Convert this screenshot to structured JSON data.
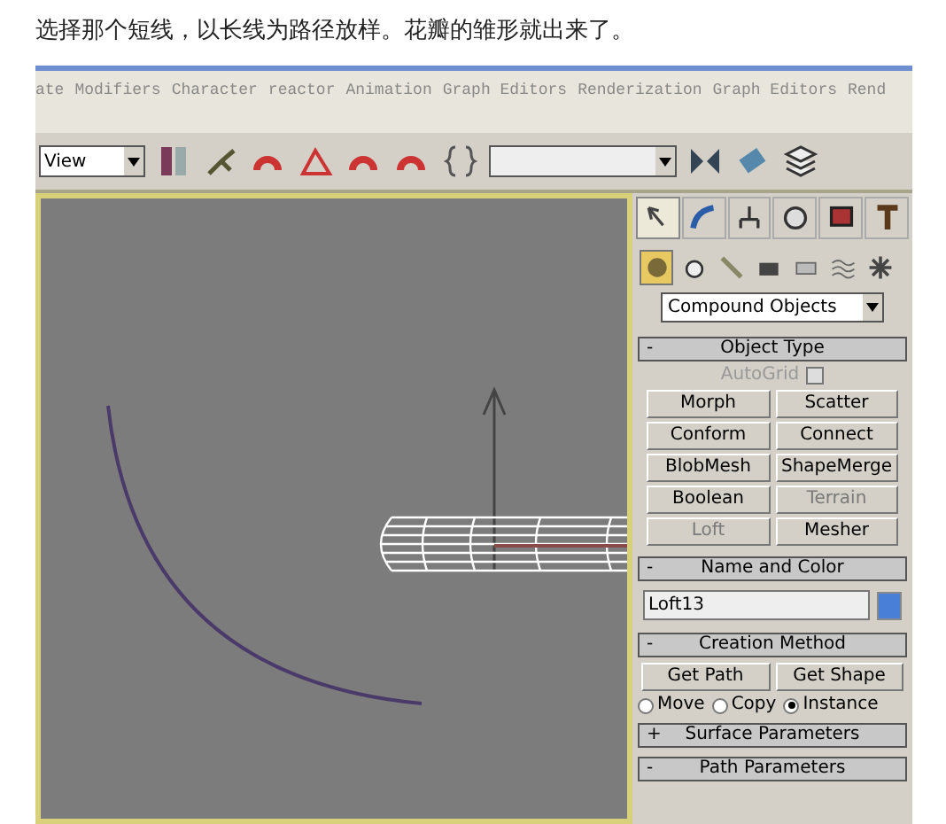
{
  "caption": "选择那个短线，以长线为路径放样。花瓣的雏形就出来了。",
  "menu": [
    "ate",
    "Modifiers",
    "Character",
    "reactor",
    "Animation",
    "Graph Editors",
    "Renderization",
    "Graph Editors",
    "Rend"
  ],
  "toolbar": {
    "view_dropdown": "View"
  },
  "command_panel": {
    "tabs": [
      {
        "selected": true
      },
      {
        "selected": false
      },
      {
        "selected": false
      },
      {
        "selected": false
      },
      {
        "selected": false
      },
      {
        "selected": false
      }
    ],
    "categories": [
      {
        "selected": true
      },
      {
        "selected": false
      },
      {
        "selected": false
      },
      {
        "selected": false
      },
      {
        "selected": false
      },
      {
        "selected": false
      },
      {
        "selected": false
      }
    ],
    "type_dropdown": "Compound Objects",
    "object_type": {
      "toggle": "-",
      "title": "Object Type",
      "autogrid": {
        "label": "AutoGrid",
        "checked": false,
        "disabled": true
      },
      "buttons": [
        {
          "label": "Morph",
          "disabled": false
        },
        {
          "label": "Scatter",
          "disabled": false
        },
        {
          "label": "Conform",
          "disabled": false
        },
        {
          "label": "Connect",
          "disabled": false
        },
        {
          "label": "BlobMesh",
          "disabled": false
        },
        {
          "label": "ShapeMerge",
          "disabled": false
        },
        {
          "label": "Boolean",
          "disabled": false
        },
        {
          "label": "Terrain",
          "disabled": true
        },
        {
          "label": "Loft",
          "disabled": true
        },
        {
          "label": "Mesher",
          "disabled": false
        }
      ]
    },
    "name_and_color": {
      "toggle": "-",
      "title": "Name and Color",
      "name": "Loft13",
      "color": "#4a7fd8"
    },
    "creation_method": {
      "toggle": "-",
      "title": "Creation Method",
      "buttons": [
        "Get Path",
        "Get Shape"
      ],
      "options": [
        {
          "label": "Move",
          "selected": false
        },
        {
          "label": "Copy",
          "selected": false
        },
        {
          "label": "Instance",
          "selected": true
        }
      ]
    },
    "collapsed_rollouts": [
      {
        "toggle": "+",
        "title": "Surface Parameters"
      },
      {
        "toggle": "-",
        "title": "Path Parameters"
      }
    ]
  }
}
